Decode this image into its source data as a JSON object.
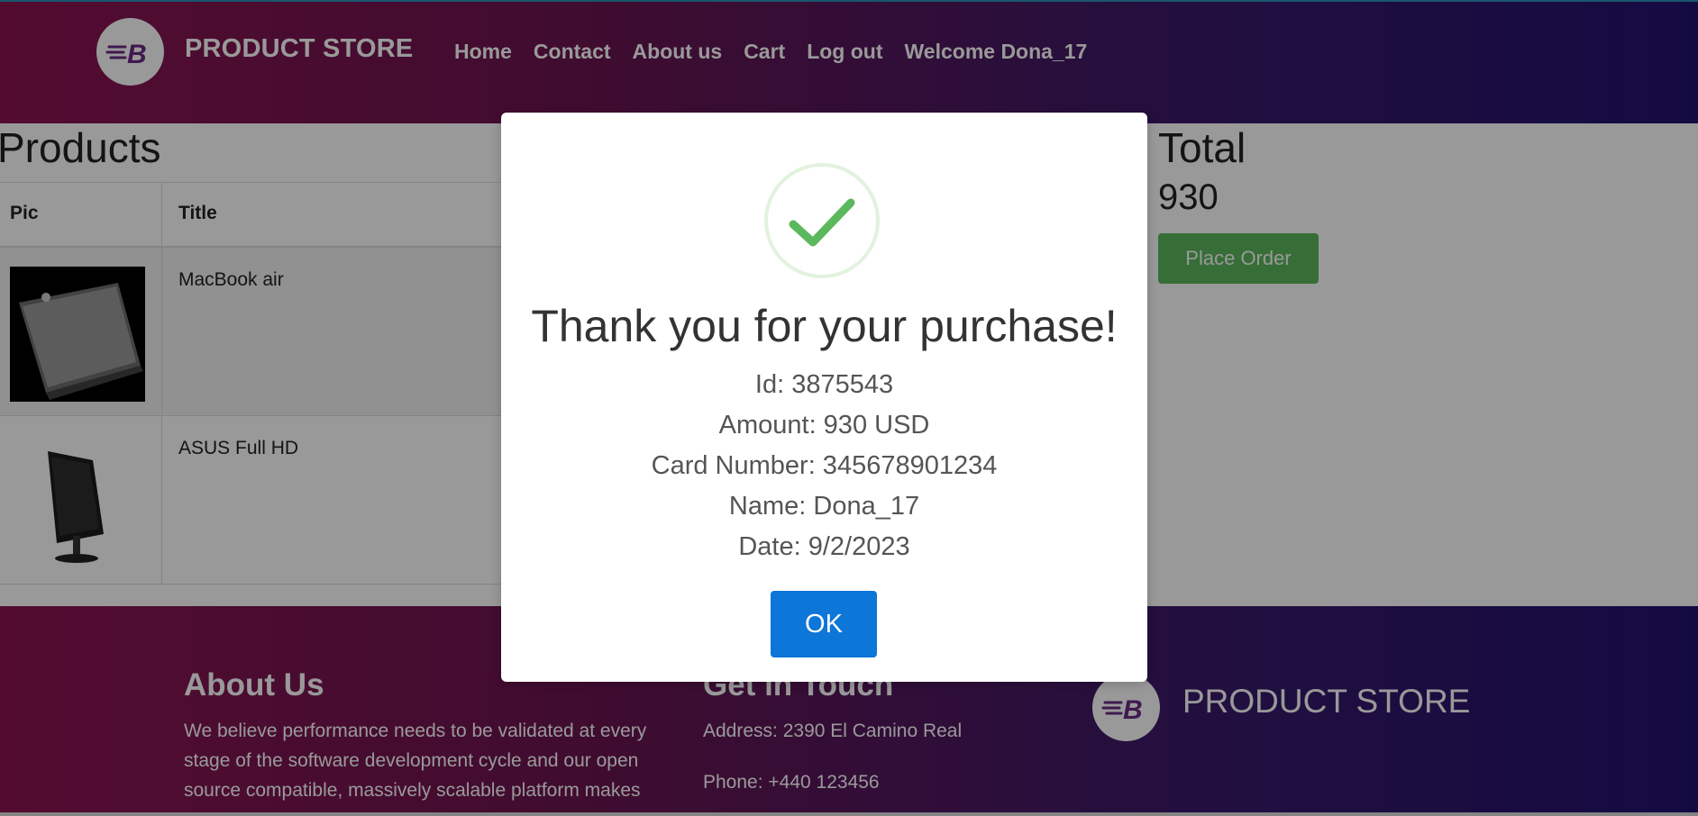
{
  "header": {
    "brand": "PRODUCT STORE",
    "nav": [
      "Home",
      "Contact",
      "About us",
      "Cart",
      "Log out",
      "Welcome Dona_17"
    ]
  },
  "cart": {
    "title": "Products",
    "columns": {
      "pic": "Pic",
      "title": "Title"
    },
    "rows": [
      {
        "title": "MacBook air",
        "image": "macbook-image"
      },
      {
        "title": "ASUS Full HD",
        "image": "monitor-image"
      }
    ],
    "total_label": "Total",
    "total_value": "930",
    "place_order": "Place Order"
  },
  "modal": {
    "heading": "Thank you for your purchase!",
    "id": "Id: 3875543",
    "amount": "Amount: 930 USD",
    "card": "Card Number: 345678901234",
    "name": "Name: Dona_17",
    "date": "Date: 9/2/2023",
    "ok": "OK",
    "icon": "checkmark-icon",
    "accent": "#5cb85c"
  },
  "footer": {
    "about_title": "About Us",
    "about_lines": [
      "We believe performance needs to be validated at every",
      "stage of the software development cycle and our open",
      "source compatible, massively scalable platform makes"
    ],
    "contact_title": "Get in Touch",
    "address": "Address: 2390 El Camino Real",
    "phone": "Phone: +440 123456",
    "brand": "PRODUCT STORE"
  },
  "colors": {
    "header_gradient_start": "#8a1550",
    "header_gradient_end": "#22126e",
    "place_order": "#5cb85c",
    "ok_button": "#0d76d9"
  }
}
